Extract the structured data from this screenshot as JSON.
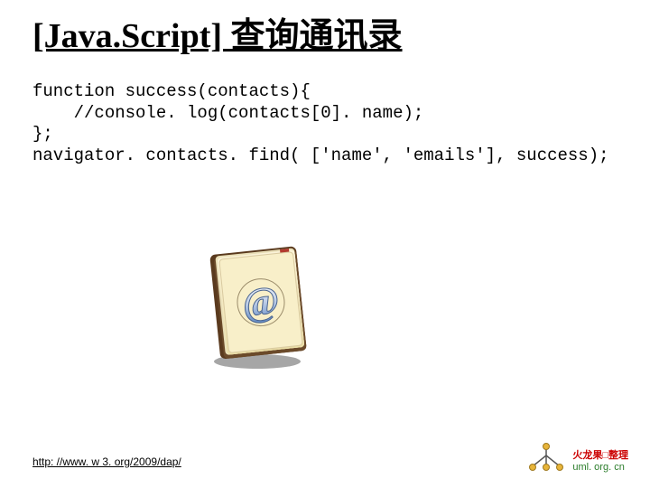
{
  "title": "[Java.Script] 查询通讯录",
  "code_lines": [
    "function success(contacts){",
    "    //console. log(contacts[0]. name);",
    "};",
    "navigator. contacts. find( ['name', 'emails'], success);"
  ],
  "addressbook_icon_name": "addressbook-icon",
  "footer_link": "http: //www. w 3. org/2009/dap/",
  "brand": {
    "line1": "火龙果□整理",
    "line2": "uml. org. cn"
  }
}
